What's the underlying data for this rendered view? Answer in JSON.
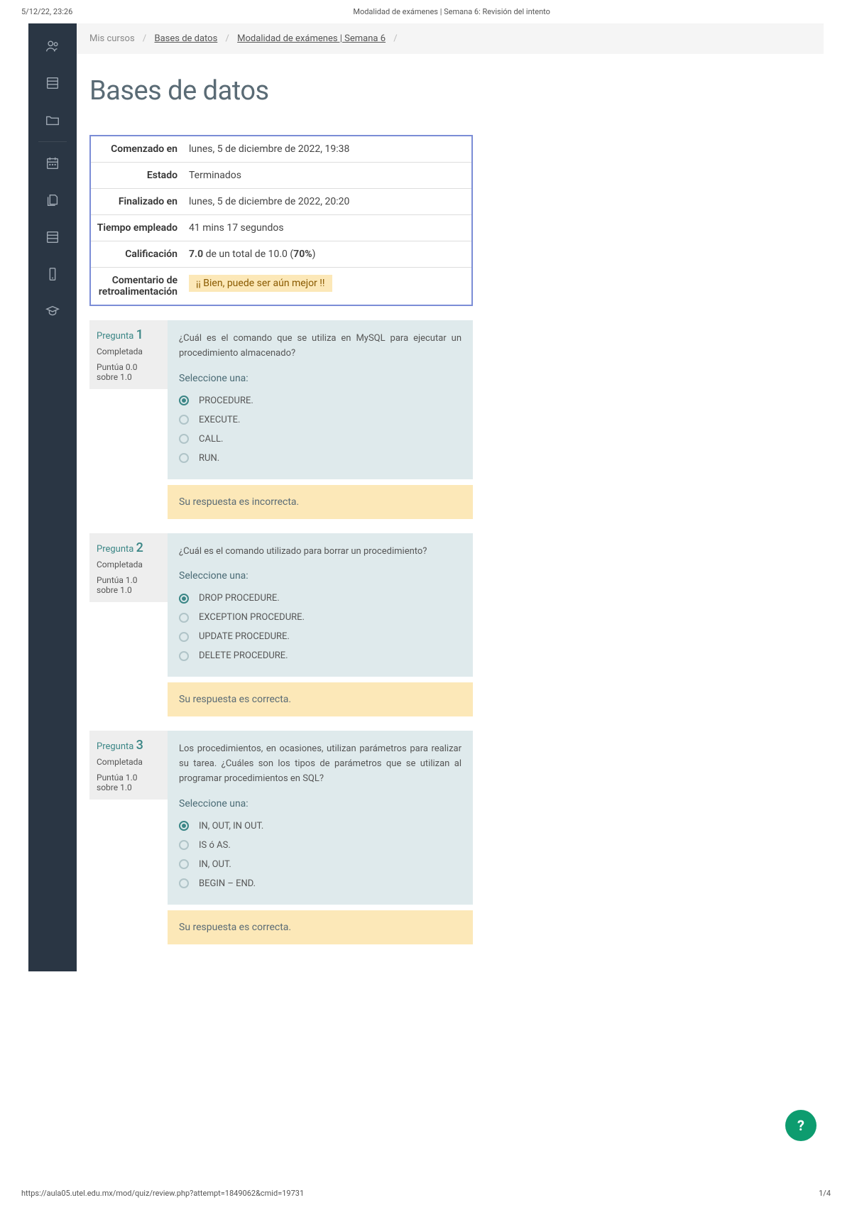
{
  "print": {
    "timestamp": "5/12/22, 23:26",
    "doc_title": "Modalidad de exámenes | Semana 6: Revisión del intento",
    "footer_url": "https://aula05.utel.edu.mx/mod/quiz/review.php?attempt=1849062&cmid=19731",
    "footer_page": "1/4"
  },
  "breadcrumb": {
    "root": "Mis cursos",
    "course": "Bases de datos",
    "item": "Modalidad de exámenes | Semana 6"
  },
  "page_title": "Bases de datos",
  "summary": {
    "labels": {
      "started": "Comenzado en",
      "state": "Estado",
      "completed": "Finalizado en",
      "time": "Tiempo empleado",
      "grade": "Calificación",
      "feedback": "Comentario de retroalimentación"
    },
    "started": "lunes, 5 de diciembre de 2022, 19:38",
    "state": "Terminados",
    "completed": "lunes, 5 de diciembre de 2022, 20:20",
    "time": "41 mins 17 segundos",
    "grade_score": "7.0",
    "grade_mid": " de un total de 10.0 (",
    "grade_pct": "70%",
    "grade_close": ")",
    "feedback": "¡¡ Bien, puede ser aún mejor !!"
  },
  "questions": [
    {
      "label": "Pregunta",
      "number": "1",
      "state": "Completada",
      "grade": "Puntúa 0.0 sobre 1.0",
      "text": "¿Cuál es el comando que se utiliza en MySQL para ejecutar un procedimiento almacenado?",
      "prompt": "Seleccione una:",
      "answers": [
        {
          "text": "PROCEDURE.",
          "selected": true
        },
        {
          "text": "EXECUTE.",
          "selected": false
        },
        {
          "text": "CALL.",
          "selected": false
        },
        {
          "text": "RUN.",
          "selected": false
        }
      ],
      "feedback": "Su respuesta es incorrecta."
    },
    {
      "label": "Pregunta",
      "number": "2",
      "state": "Completada",
      "grade": "Puntúa 1.0 sobre 1.0",
      "text": "¿Cuál es el comando utilizado para borrar un procedimiento?",
      "prompt": "Seleccione una:",
      "answers": [
        {
          "text": "DROP PROCEDURE.",
          "selected": true
        },
        {
          "text": "EXCEPTION PROCEDURE.",
          "selected": false
        },
        {
          "text": "UPDATE PROCEDURE.",
          "selected": false
        },
        {
          "text": "DELETE PROCEDURE.",
          "selected": false
        }
      ],
      "feedback": "Su respuesta es correcta."
    },
    {
      "label": "Pregunta",
      "number": "3",
      "state": "Completada",
      "grade": "Puntúa 1.0 sobre 1.0",
      "text": "Los procedimientos, en ocasiones, utilizan parámetros para realizar su tarea. ¿Cuáles son los tipos de parámetros que se utilizan al programar procedimientos en SQL?",
      "prompt": "Seleccione una:",
      "answers": [
        {
          "text": "IN, OUT, IN OUT.",
          "selected": true
        },
        {
          "text": "IS ó AS.",
          "selected": false
        },
        {
          "text": "IN, OUT.",
          "selected": false
        },
        {
          "text": "BEGIN – END.",
          "selected": false
        }
      ],
      "feedback": "Su respuesta es correcta."
    }
  ],
  "help_fab": "?"
}
